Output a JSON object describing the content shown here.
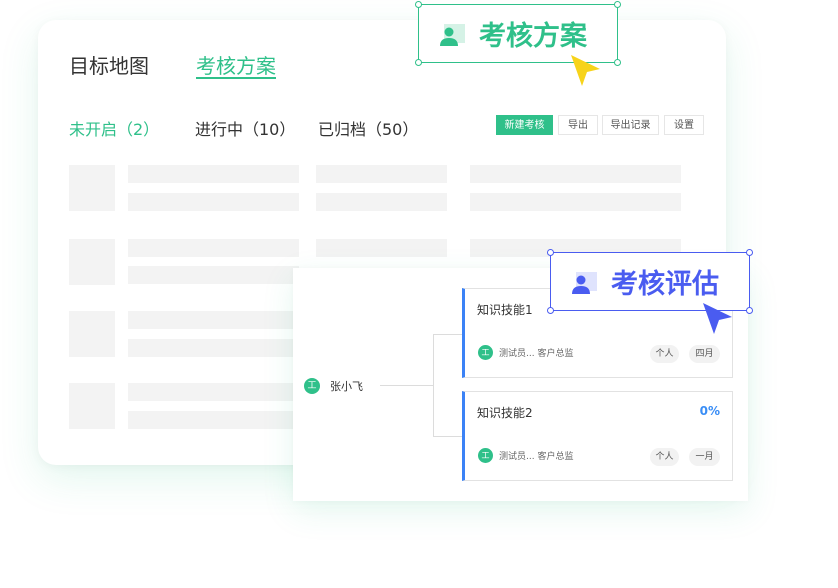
{
  "colors": {
    "brand_green": "#2fc08a",
    "accent_blue": "#4a5cf0",
    "bar_blue": "#3b82f6"
  },
  "top_tabs": [
    {
      "label": "目标地图",
      "active": false
    },
    {
      "label": "考核方案",
      "active": true
    }
  ],
  "status_tabs": [
    {
      "label": "未开启（2）",
      "active": true
    },
    {
      "label": "进行中（10）",
      "active": false
    },
    {
      "label": "已归档（50）",
      "active": false
    }
  ],
  "toolbar": {
    "new_label": "新建考核",
    "export_label": "导出",
    "export_log_label": "导出记录",
    "settings_label": "设置"
  },
  "tree": {
    "root": {
      "avatar": "工",
      "name": "张小飞"
    },
    "skills": [
      {
        "title": "知识技能1",
        "percent": "",
        "owner_avatar": "工",
        "owner": "测试员... 客户总监",
        "tags": [
          "个人",
          "四月"
        ]
      },
      {
        "title": "知识技能2",
        "percent": "0%",
        "owner_avatar": "工",
        "owner": "测试员... 客户总监",
        "tags": [
          "个人",
          "一月"
        ]
      }
    ]
  },
  "callouts": {
    "green": {
      "label": "考核方案",
      "icon": "user-icon",
      "color": "#2fc08a"
    },
    "blue": {
      "label": "考核评估",
      "icon": "user-icon",
      "color": "#4a5cf0"
    }
  }
}
